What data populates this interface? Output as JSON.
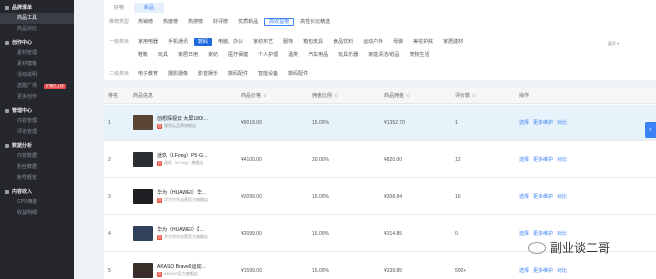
{
  "sidebar": {
    "groups": [
      {
        "title": "品牌清单",
        "items": [
          {
            "label": "商品工具",
            "active": true
          },
          {
            "label": "商品对比"
          }
        ]
      },
      {
        "title": "创作中心",
        "items": [
          {
            "label": "素材管理"
          },
          {
            "label": "素材模板"
          },
          {
            "label": "活动说明"
          },
          {
            "label": "选题广场",
            "badge": "扩展已上线"
          },
          {
            "label": "更多创作"
          }
        ]
      },
      {
        "title": "管理中心",
        "items": [
          {
            "label": "内容管理"
          },
          {
            "label": "评论管理"
          }
        ]
      },
      {
        "title": "数据分析",
        "items": [
          {
            "label": "内容数据"
          },
          {
            "label": "粉丝数据"
          },
          {
            "label": "账号概览"
          }
        ]
      },
      {
        "title": "内容收入",
        "items": [
          {
            "label": "CPS佣金"
          },
          {
            "label": "收益明细"
          }
        ]
      }
    ]
  },
  "filters": {
    "tabs": [
      {
        "label": "好物",
        "active": false
      },
      {
        "label": "新品",
        "active": true
      }
    ],
    "rows": [
      {
        "label": "推荐类型",
        "chips": [
          {
            "label": "热销榜"
          },
          {
            "label": "热度榜"
          },
          {
            "label": "热搜榜"
          },
          {
            "label": "好评榜"
          },
          {
            "label": "优质新品"
          },
          {
            "label": "高收益榜",
            "state": "active"
          },
          {
            "label": "高性价比精选"
          }
        ]
      },
      {
        "label": "一级类目",
        "chips": [
          {
            "label": "家用电器"
          },
          {
            "label": "手机通讯"
          },
          {
            "label": "数码",
            "state": "sel"
          },
          {
            "label": "电脑、办公"
          },
          {
            "label": "家纺布艺"
          },
          {
            "label": "服饰"
          },
          {
            "label": "箱包皮具"
          },
          {
            "label": "食品饮料"
          },
          {
            "label": "运动户外"
          },
          {
            "label": "母婴"
          },
          {
            "label": "美妆护肤"
          },
          {
            "label": "家居建材"
          }
        ]
      },
      {
        "label": "",
        "chips": [
          {
            "label": "鞋靴"
          },
          {
            "label": "玩具"
          },
          {
            "label": "家居日用"
          },
          {
            "label": "家纺"
          },
          {
            "label": "医疗保健"
          },
          {
            "label": "个人护理"
          },
          {
            "label": "酒类"
          },
          {
            "label": "汽车用品"
          },
          {
            "label": "玩具乐器"
          },
          {
            "label": "家庭清洁/纸品"
          },
          {
            "label": "宠物生活"
          }
        ]
      },
      {
        "label": "二级类目",
        "chips": [
          {
            "label": "电子教育"
          },
          {
            "label": "摄影摄像"
          },
          {
            "label": "影音娱乐"
          },
          {
            "label": "数码配件"
          },
          {
            "label": "智能设备"
          },
          {
            "label": "数码配件"
          }
        ]
      }
    ],
    "more_label": "展开 ▾"
  },
  "table": {
    "columns": [
      {
        "label": "排名"
      },
      {
        "label": "商品信息"
      },
      {
        "label": "商品价格",
        "sortable": true
      },
      {
        "label": "佣金比例",
        "sortable": true
      },
      {
        "label": "商品佣金",
        "sortable": true
      },
      {
        "label": "评价数",
        "sortable": true
      },
      {
        "label": "操作"
      }
    ],
    "sort_glyph": "⇅",
    "rows": [
      {
        "rank": "1",
        "name": "创想探视云 大屏180/…",
        "shop": "猫视云品牌旗舰店",
        "price": "¥9018.00",
        "rate": "15.00%",
        "commission": "¥1352.70",
        "reviews": "1",
        "thumb": "#5a4632"
      },
      {
        "rank": "2",
        "name": "迷玖（LFong）P5·G…",
        "shop": "迷玖（LFong）旗舰店",
        "price": "¥4100.00",
        "rate": "20.00%",
        "commission": "¥820.00",
        "reviews": "12",
        "thumb": "#2b2e33"
      },
      {
        "rank": "3",
        "name": "华为（HUAWEI）华…",
        "shop": "华为京东自营官方旗舰店",
        "price": "¥2099.00",
        "rate": "15.00%",
        "commission": "¥308.84",
        "reviews": "10",
        "thumb": "#1e1f22"
      },
      {
        "rank": "4",
        "name": "华为（HUAWEI）【…",
        "shop": "华为京东自营官方旗舰店",
        "price": "¥2099.00",
        "rate": "15.00%",
        "commission": "¥314.85",
        "reviews": "0",
        "thumb": "#30425a"
      },
      {
        "rank": "5",
        "name": "AKASO Brave6运动…",
        "shop": "AKASO官方旗舰店",
        "price": "¥1599.00",
        "rate": "15.00%",
        "commission": "¥239.85",
        "reviews": "500+",
        "thumb": "#3a2e2a"
      }
    ],
    "shop_badge": "自",
    "actions": [
      "选择",
      "更多维护",
      "对比"
    ]
  },
  "side_tab": "<",
  "watermark": "副业谈二哥",
  "colors": {
    "accent": "#3b82f6",
    "sidebar_bg": "#25272d",
    "row_highlight": "#e7f3fb"
  }
}
